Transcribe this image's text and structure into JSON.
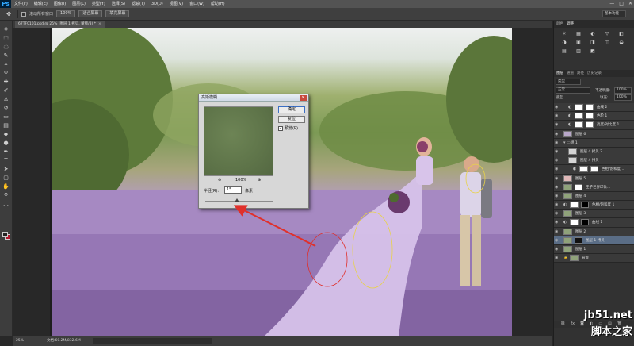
{
  "app": {
    "logo": "Ps"
  },
  "menu": {
    "items": [
      "文件(F)",
      "编辑(E)",
      "图像(I)",
      "图层(L)",
      "类型(Y)",
      "选择(S)",
      "滤镜(T)",
      "3D(D)",
      "视图(V)",
      "窗口(W)",
      "帮助(H)"
    ],
    "win_min": "—",
    "win_max": "□",
    "win_close": "✕"
  },
  "options": {
    "tool_icon": "move-tool-icon",
    "scroll_all_windows": "滚动所有窗口",
    "zoom_100": "100%",
    "fit_screen": "适合屏幕",
    "fill_screen": "填充屏幕",
    "workspace": "基本功能"
  },
  "document": {
    "tab_title": "67TF0101.psd @ 25% (图层 1 拷贝, 蒙版/8) *",
    "tab_close": "×"
  },
  "dialog": {
    "title": "高斯模糊",
    "ok": "确定",
    "reset": "复位",
    "preview_check": "✓",
    "preview_label": "预览(P)",
    "zoom_out": "⊖",
    "zoom_in": "⊕",
    "zoom_value": "100%",
    "radius_label": "半径(R):",
    "radius_value": "15",
    "radius_unit": "像素",
    "close": "✕",
    "slider_position": 0.46
  },
  "dock": {
    "top_tabs": [
      "颜色",
      "调整"
    ],
    "adjust_icons": [
      "☀",
      "▦",
      "◐",
      "▽",
      "◧",
      "◑",
      "▣",
      "◨",
      "◫",
      "◒",
      "▤",
      "▥",
      "◩"
    ],
    "layer_tabs": [
      "图层",
      "通道",
      "路径",
      "历史记录"
    ],
    "kind": "类型",
    "blend": "正常",
    "opacity_label": "不透明度:",
    "opacity": "100%",
    "lock_label": "锁定:",
    "fill_label": "填充:",
    "fill": "100%"
  },
  "layers": [
    {
      "name": "曲线 2",
      "thumb": "#ffffff",
      "mask": "#ffffff",
      "indent": 1,
      "fx": "◐"
    },
    {
      "name": "色阶 1",
      "thumb": "#ffffff",
      "mask": "#ffffff",
      "indent": 1,
      "fx": "◐"
    },
    {
      "name": "亮度/对比度 1",
      "thumb": "#ffffff",
      "mask": "#ffffff",
      "indent": 1,
      "fx": "◐"
    },
    {
      "name": "图层 6",
      "thumb": "#b8a7c9",
      "mask": "",
      "indent": 0,
      "fx": ""
    },
    {
      "name": "组 1",
      "thumb": "",
      "mask": "",
      "indent": 0,
      "fx": "▾ ▭"
    },
    {
      "name": "图层 4 拷贝 2",
      "thumb": "#d5d5d5",
      "mask": "",
      "indent": 1,
      "fx": ""
    },
    {
      "name": "图层 4 拷贝",
      "thumb": "#d5d5d5",
      "mask": "",
      "indent": 1,
      "fx": ""
    },
    {
      "name": "色相/饱和度...",
      "thumb": "#ffffff",
      "mask": "#ffffff",
      "indent": 2,
      "fx": "◐"
    },
    {
      "name": "图层 5",
      "thumb": "#e0b8b8",
      "mask": "",
      "indent": 0,
      "fx": ""
    },
    {
      "name": "王子世界印象...",
      "thumb": "#8fa27a",
      "mask": "#ffffff",
      "indent": 0,
      "fx": ""
    },
    {
      "name": "图层 4",
      "thumb": "#8fa27a",
      "mask": "",
      "indent": 0,
      "fx": ""
    },
    {
      "name": "色相/饱和度 1",
      "thumb": "#ffffff",
      "mask": "#000000",
      "indent": 0,
      "fx": "◐"
    },
    {
      "name": "图层 3",
      "thumb": "#8fa27a",
      "mask": "",
      "indent": 0,
      "fx": ""
    },
    {
      "name": "曲线 1",
      "thumb": "#ffffff",
      "mask": "#000000",
      "indent": 0,
      "fx": "◐"
    },
    {
      "name": "图层 2",
      "thumb": "#8fa27a",
      "mask": "",
      "indent": 0,
      "fx": ""
    },
    {
      "name": "图层 1 拷贝",
      "thumb": "#8fa27a",
      "mask": "#111111",
      "indent": 0,
      "fx": "",
      "selected": true
    },
    {
      "name": "图层 1",
      "thumb": "#8fa27a",
      "mask": "",
      "indent": 0,
      "fx": ""
    },
    {
      "name": "背景",
      "thumb": "#8fa27a",
      "mask": "",
      "indent": 0,
      "fx": "🔒"
    }
  ],
  "layers_footer": [
    "⛓",
    "fx",
    "◙",
    "◐",
    "▭",
    "▤",
    "🗑"
  ],
  "status": {
    "zoom": "25%",
    "doc": "文档:60.2M/832.6M"
  },
  "watermark": {
    "url": "jb51.net",
    "cn": "脚本之家"
  },
  "colors": {
    "arrow": "#e0302b",
    "circle_red": "#e0302b",
    "circle_yellow": "#e8d24a",
    "fg": "#222222",
    "bg": "#b0152c"
  }
}
